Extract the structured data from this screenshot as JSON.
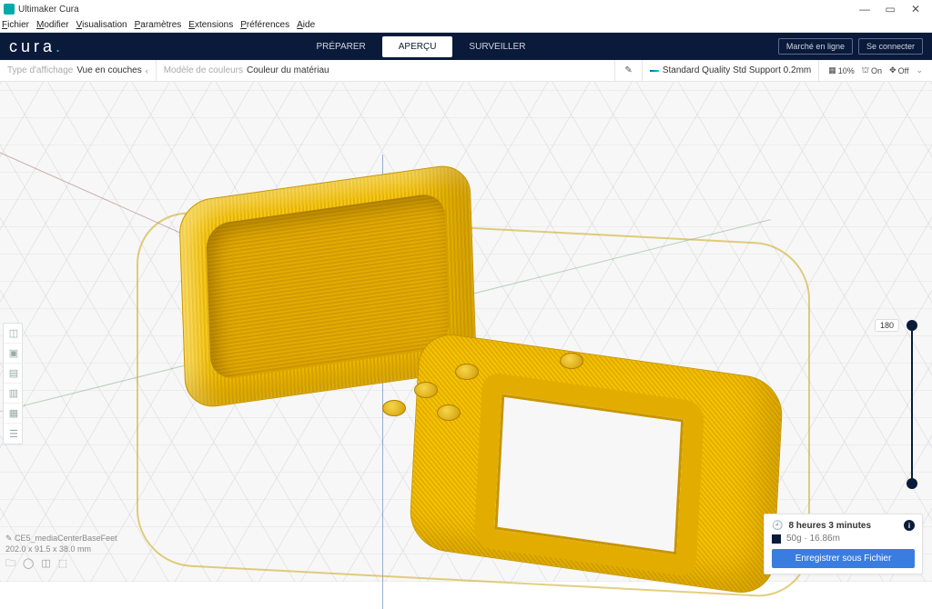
{
  "window": {
    "title": "Ultimaker Cura"
  },
  "menu": {
    "items": [
      "Fichier",
      "Modifier",
      "Visualisation",
      "Paramètres",
      "Extensions",
      "Préférences",
      "Aide"
    ]
  },
  "header": {
    "logo": "cura",
    "tabs": {
      "prepare": "PRÉPARER",
      "preview": "APERÇU",
      "monitor": "SURVEILLER"
    },
    "marketplace": "Marché en ligne",
    "signin": "Se connecter"
  },
  "settingsbar": {
    "viewtype_lbl": "Type d'affichage",
    "viewtype_val": "Vue en couches",
    "colorscheme_lbl": "Modèle de couleurs",
    "colorscheme_val": "Couleur du matériau",
    "profile": "Standard Quality Std Support 0.2mm",
    "infill_val": "10%",
    "support_val": "On",
    "adhesion_val": "Off"
  },
  "layer": {
    "max": "180"
  },
  "object": {
    "name": "CE5_mediaCenterBaseFeet",
    "dims": "202.0 x 91.5 x 38.0 mm"
  },
  "estimate": {
    "time": "8 heures 3 minutes",
    "material": "50g · 16.86m",
    "save": "Enregistrer sous Fichier"
  }
}
